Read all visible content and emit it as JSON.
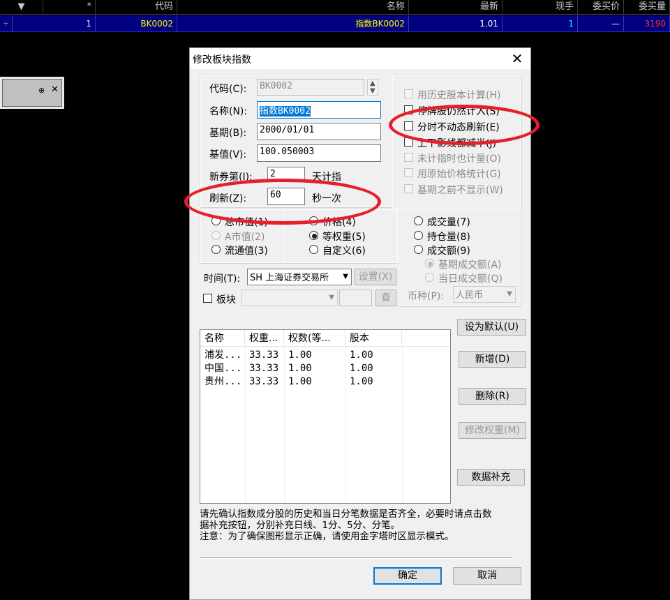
{
  "quote_table": {
    "headers": [
      "▼",
      "*",
      "代码",
      "名称",
      "最新",
      "现手",
      "委买价",
      "委买量"
    ],
    "row": {
      "index": "1",
      "code": "BK0002",
      "name": "指数BK0002",
      "latest": "1.01",
      "volume_now": "1",
      "bid_price": "—",
      "bid_qty": "3190"
    }
  },
  "float_panel": {
    "pin": "⊕",
    "close": "✕"
  },
  "dialog": {
    "title": "修改板块指数",
    "close_label": "✕",
    "fields": {
      "code_label": "代码(C):",
      "code_value": "BK0002",
      "name_label": "名称(N):",
      "name_value": "指数BK0002",
      "base_date_label": "基期(B):",
      "base_date_value": "2000/01/01",
      "base_value_label": "基值(V):",
      "base_value_value": "100.050003",
      "new_stock_label": "新券第(I):",
      "new_stock_value": "2",
      "new_stock_suffix": "天计指",
      "refresh_label": "刷新(Z):",
      "refresh_value": "60",
      "refresh_suffix": "秒一次"
    },
    "options": {
      "opt1": "用历史股本计算(H)",
      "opt2": "停牌股仍然计入(S)",
      "opt3": "分时不动态刷新(E)",
      "opt4": "上下影线都减半(J)",
      "opt5": "未计指时也计量(O)",
      "opt6": "用原始价格统计(G)",
      "opt7": "基期之前不显示(W)"
    },
    "weight_base": {
      "total_cap": "总市值(1)",
      "a_cap": "A市值(2)",
      "float_cap": "流通值(3)"
    },
    "weight_mode": {
      "price": "价格(4)",
      "equal": "等权重(5)",
      "custom": "自定义(6)"
    },
    "volume_mode": {
      "vol": "成交量(7)",
      "oi": "持仓量(8)",
      "amount": "成交额(9)",
      "base_amount": "基期成交额(A)",
      "day_amount": "当日成交额(Q)",
      "currency_label": "币种(P):",
      "currency_value": "人民币"
    },
    "time": {
      "label": "时间(T):",
      "value": "SH 上海证券交易所",
      "set_button": "设置(X)"
    },
    "block": {
      "label": "板块",
      "search_button": "查"
    },
    "list": {
      "columns": [
        "名称",
        "权重...",
        "权数(等...",
        "股本"
      ],
      "rows": [
        [
          "浦发...",
          "33.33",
          "1.00",
          "1.00"
        ],
        [
          "中国...",
          "33.33",
          "1.00",
          "1.00"
        ],
        [
          "贵州...",
          "33.33",
          "1.00",
          "1.00"
        ]
      ]
    },
    "side_buttons": {
      "set_default": "设为默认(U)",
      "add": "新增(D)",
      "delete": "删除(R)",
      "edit_weight": "修改权重(M)",
      "data_fill": "数据补充"
    },
    "notes": {
      "line1": "请先确认指数成分股的历史和当日分笔数据是否齐全，必要时请点击数",
      "line2": "据补充按钮，分别补充日线、1分、5分、分笔。",
      "line3": "注意：为了确保图形显示正确，请使用金字塔时区显示模式。"
    },
    "ok": "确定",
    "cancel": "取消"
  },
  "colors": {
    "row_bg": "#000080",
    "annotation": "#e5202c",
    "accent": "#0078d7"
  }
}
